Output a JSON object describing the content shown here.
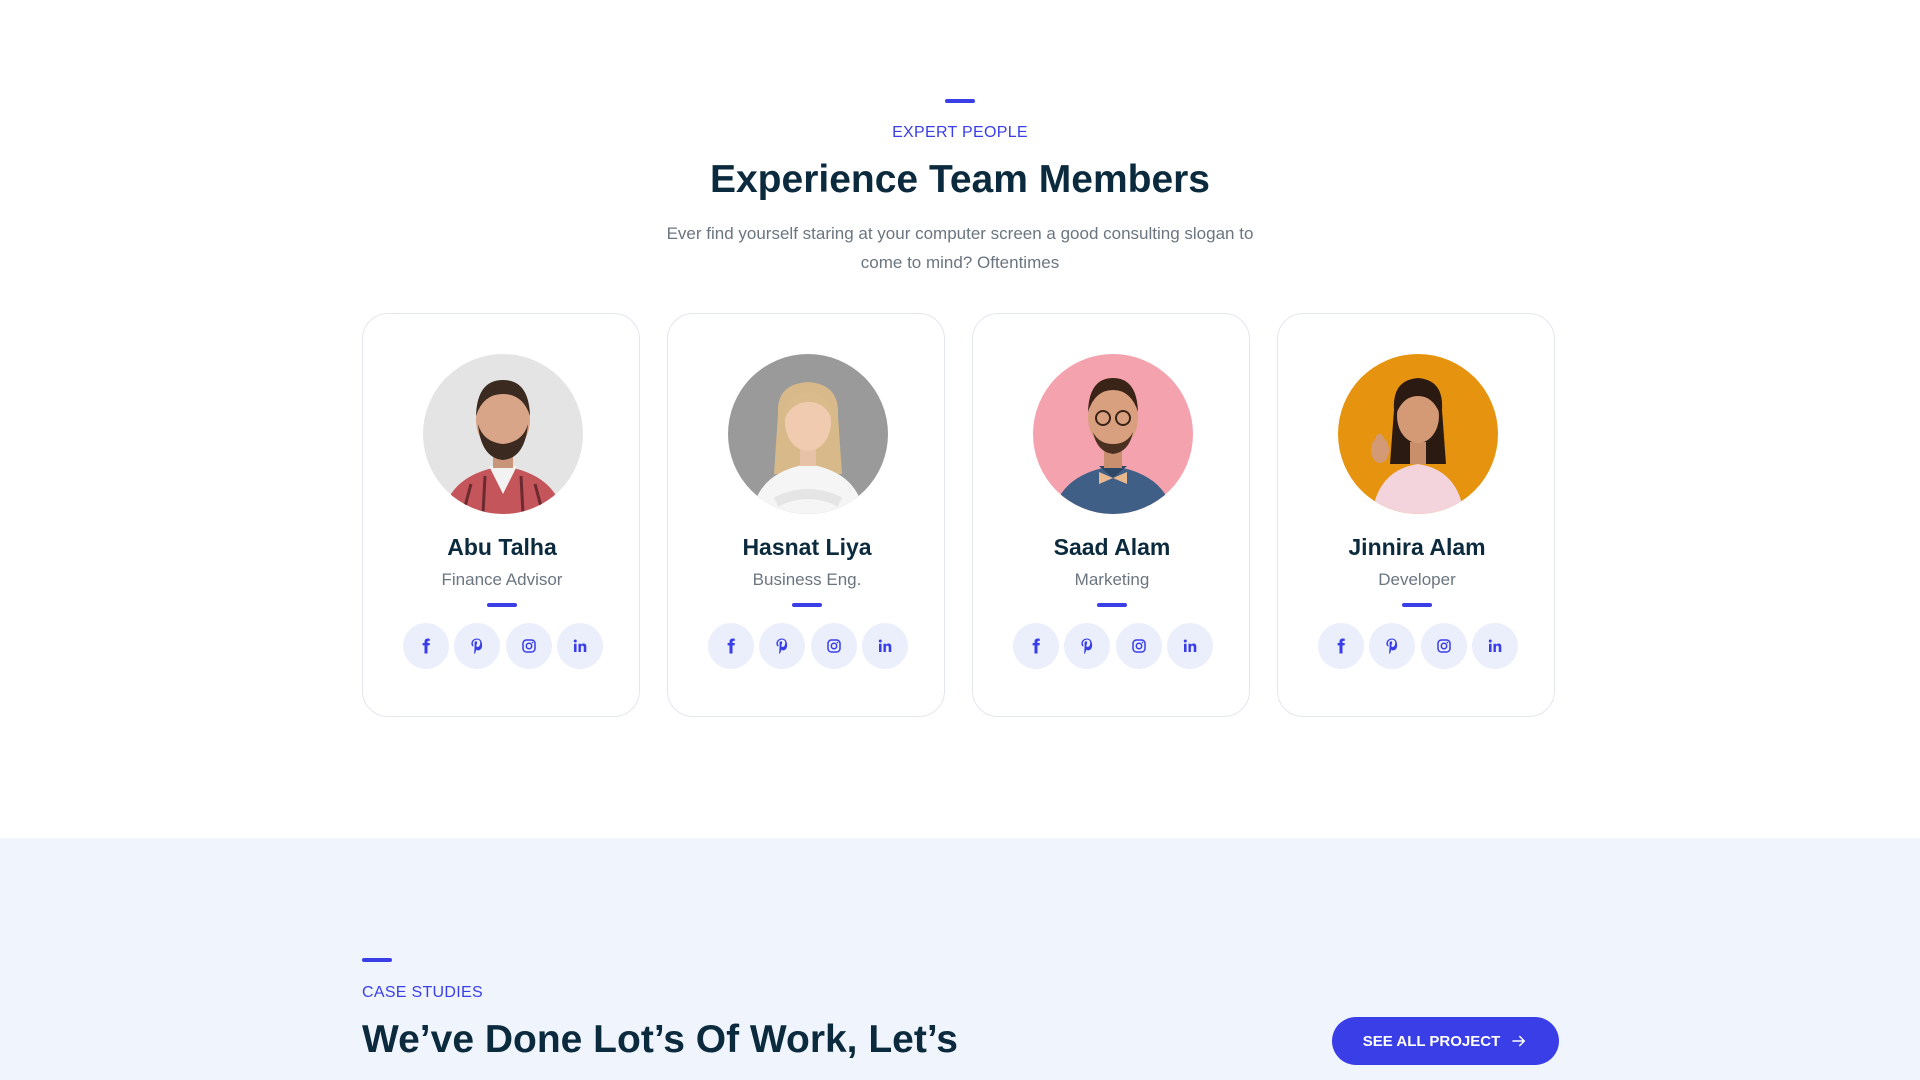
{
  "team_section": {
    "eyebrow": "EXPERT PEOPLE",
    "title": "Experience Team Members",
    "subtitle": "Ever find yourself staring at your computer screen a good consulting slogan to come to mind? Oftentimes",
    "members": [
      {
        "name": "Abu Talha",
        "role": "Finance Advisor",
        "avatar_bg": "#e4e4e4"
      },
      {
        "name": "Hasnat Liya",
        "role": "Business Eng.",
        "avatar_bg": "#9a9a9a"
      },
      {
        "name": "Saad Alam",
        "role": "Marketing",
        "avatar_bg": "#f4a2ae"
      },
      {
        "name": "Jinnira Alam",
        "role": "Developer",
        "avatar_bg": "#e6940f"
      }
    ],
    "social_icons": [
      "facebook-icon",
      "pinterest-icon",
      "instagram-icon",
      "linkedin-icon"
    ]
  },
  "cases_section": {
    "eyebrow": "CASE STUDIES",
    "title": "We’ve Done Lot’s Of Work, Let’s",
    "cta_label": "SEE ALL PROJECT"
  },
  "colors": {
    "accent": "#3a3ee6",
    "heading": "#0b2a3d",
    "muted": "#6b7580",
    "cases_bg": "#f0f5fd"
  }
}
